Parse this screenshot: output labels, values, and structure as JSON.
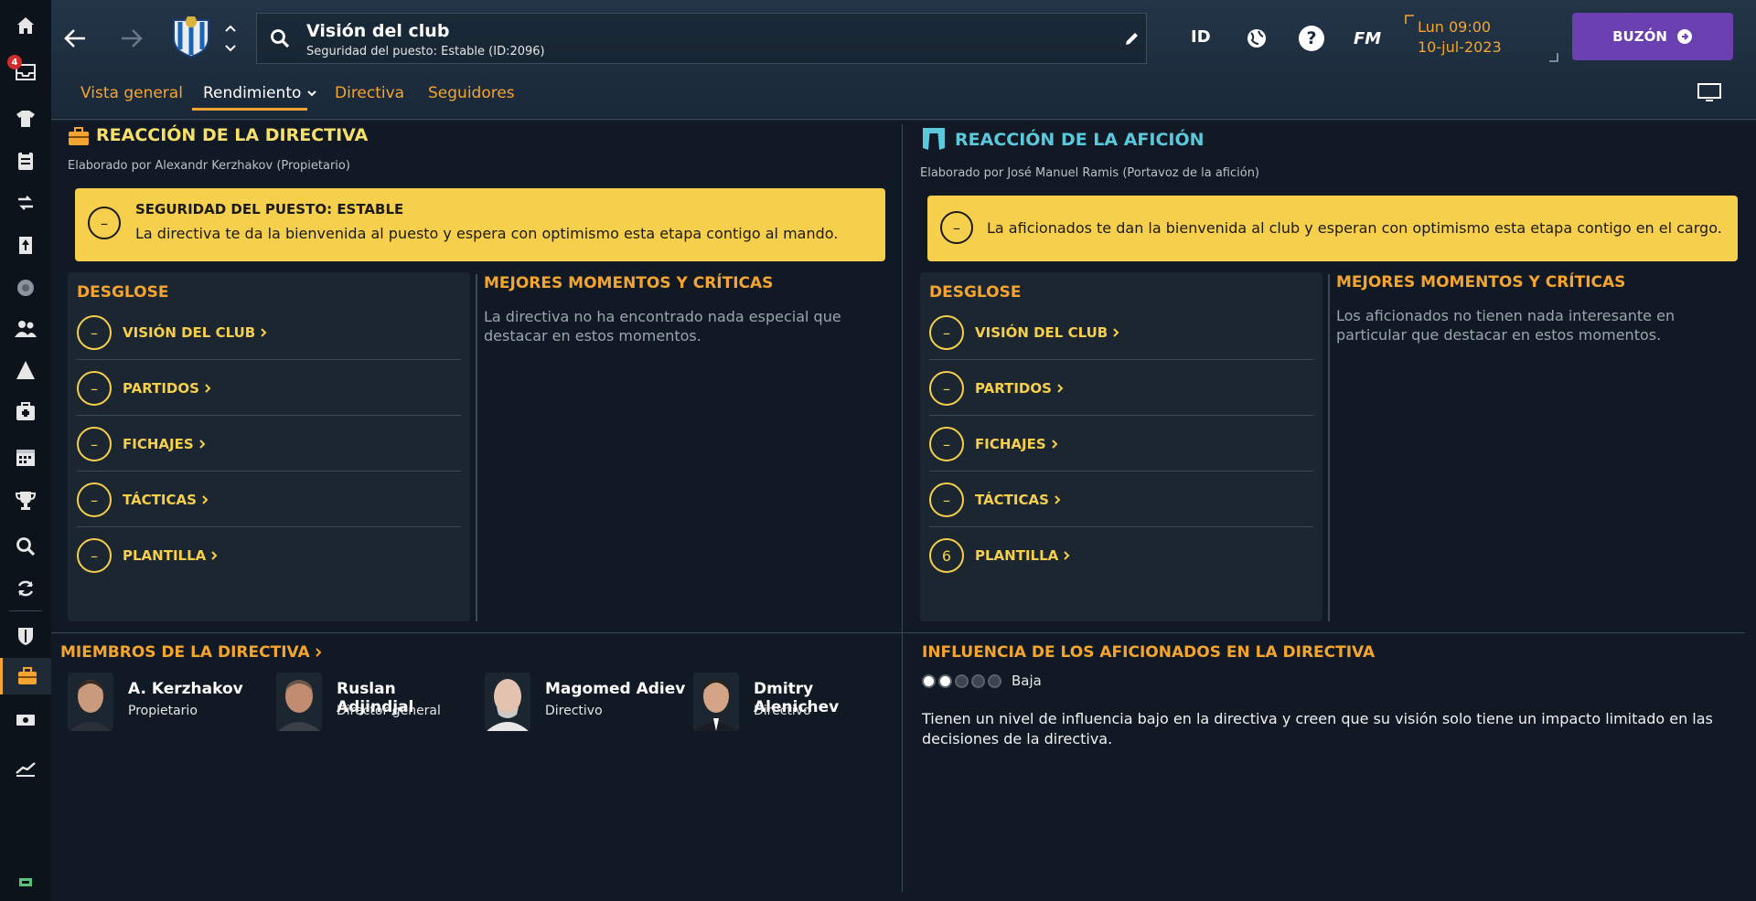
{
  "sidebar": {
    "inbox_badge": "4",
    "items": [
      "home-icon",
      "inbox-icon",
      "squad-icon",
      "clipboard-icon",
      "transfers-icon",
      "training-icon",
      "ball-icon",
      "staff-icon",
      "tactics-icon",
      "medical-icon",
      "calendar-icon",
      "trophy-icon",
      "search-icon",
      "refresh-icon",
      "shield-icon",
      "briefcase-icon",
      "finances-icon",
      "chart-icon"
    ]
  },
  "header": {
    "title": "Visión del club",
    "subtitle": "Seguridad del puesto: Estable (ID:2096)",
    "id_label": "ID",
    "fm_label": "FM",
    "help_label": "?",
    "date_time": "Lun 09:00",
    "date_day": "10-jul-2023",
    "inbox_label": "BUZÓN",
    "tabs": [
      {
        "label": "Vista general"
      },
      {
        "label": "Rendimiento"
      },
      {
        "label": "Directiva"
      },
      {
        "label": "Seguidores"
      }
    ]
  },
  "board": {
    "title": "REACCIÓN DE LA DIRECTIVA",
    "made_by": "Elaborado por Alexandr Kerzhakov (Propietario)",
    "alert_title": "SEGURIDAD DEL PUESTO: ESTABLE",
    "alert_text": "La directiva te da la bienvenida al puesto y espera con optimismo esta etapa contigo al mando.",
    "alert_icon": "–",
    "breakdown_title": "DESGLOSE",
    "breakdown": [
      {
        "label": "VISIÓN DEL CLUB",
        "value": "–"
      },
      {
        "label": "PARTIDOS",
        "value": "–"
      },
      {
        "label": "FICHAJES",
        "value": "–"
      },
      {
        "label": "TÁCTICAS",
        "value": "–"
      },
      {
        "label": "PLANTILLA",
        "value": "–"
      }
    ],
    "best_title": "MEJORES MOMENTOS Y CRÍTICAS",
    "best_text": "La directiva no ha encontrado nada especial que destacar en estos momentos."
  },
  "fans": {
    "title": "REACCIÓN DE LA AFICIÓN",
    "made_by": "Elaborado por José Manuel Ramis (Portavoz de la afición)",
    "alert_text": "La aficionados te dan la bienvenida al club y esperan con optimismo esta etapa contigo en el cargo.",
    "alert_icon": "–",
    "breakdown_title": "DESGLOSE",
    "breakdown": [
      {
        "label": "VISIÓN DEL CLUB",
        "value": "–"
      },
      {
        "label": "PARTIDOS",
        "value": "–"
      },
      {
        "label": "FICHAJES",
        "value": "–"
      },
      {
        "label": "TÁCTICAS",
        "value": "–"
      },
      {
        "label": "PLANTILLA",
        "value": "6"
      }
    ],
    "best_title": "MEJORES MOMENTOS Y CRÍTICAS",
    "best_text": "Los aficionados no tienen nada interesante en particular que destacar en estos momentos."
  },
  "members": {
    "title": "MIEMBROS DE LA DIRECTIVA",
    "list": [
      {
        "name": "A. Kerzhakov",
        "role": "Propietario"
      },
      {
        "name": "Ruslan Adjindjal",
        "role": "Director general"
      },
      {
        "name": "Magomed Adiev",
        "role": "Directivo"
      },
      {
        "name": "Dmitry Alenichev",
        "role": "Directivo"
      }
    ]
  },
  "influence": {
    "title": "INFLUENCIA DE LOS AFICIONADOS EN LA DIRECTIVA",
    "level_label": "Baja",
    "level": 2,
    "level_max": 5,
    "text": "Tienen un nivel de influencia bajo en la directiva y creen que su visión solo tiene un impacto limitado en las decisiones de la directiva."
  },
  "colors": {
    "accent": "#f4a531",
    "alert": "#f6cf4c",
    "fans_title": "#5bc8dc",
    "board_title": "#f6e06a",
    "inbox": "#6a3fb0"
  }
}
